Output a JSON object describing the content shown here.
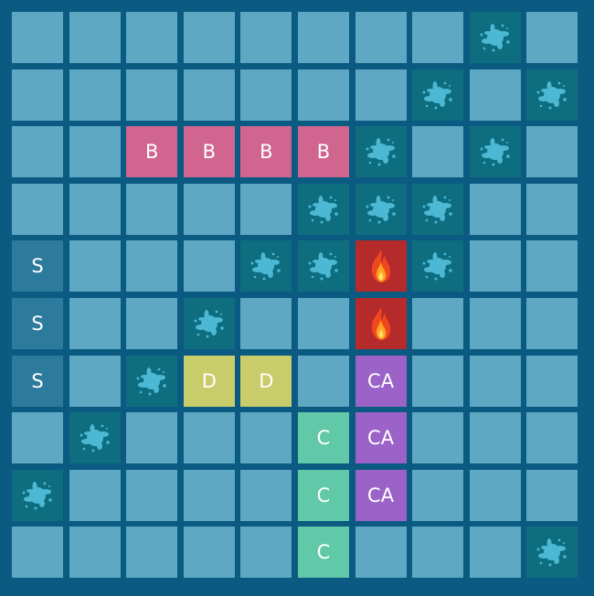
{
  "colors": {
    "water": "#5ea8c4",
    "miss": "#0e6e80",
    "splash": "#4cb8d4",
    "hit": "#b52a2a",
    "B": "#d0668f",
    "S": "#2c7a9c",
    "D": "#c9cc6a",
    "C": "#62c9a8",
    "CA": "#9b63c8"
  },
  "icons": {
    "miss": "water-splash-icon",
    "hit": "fire-icon"
  },
  "grid": [
    [
      "",
      "",
      "",
      "",
      "",
      "",
      "",
      "",
      "miss",
      ""
    ],
    [
      "",
      "",
      "",
      "",
      "",
      "",
      "",
      "miss",
      "",
      "miss"
    ],
    [
      "",
      "",
      "B",
      "B",
      "B",
      "B",
      "miss",
      "",
      "miss",
      ""
    ],
    [
      "",
      "",
      "",
      "",
      "",
      "miss",
      "miss",
      "miss",
      "",
      ""
    ],
    [
      "S",
      "",
      "",
      "",
      "miss",
      "miss",
      "hit",
      "miss",
      "",
      ""
    ],
    [
      "S",
      "",
      "",
      "miss",
      "",
      "",
      "hit",
      "",
      "",
      ""
    ],
    [
      "S",
      "",
      "miss",
      "D",
      "D",
      "",
      "CA",
      "",
      "",
      ""
    ],
    [
      "",
      "miss",
      "",
      "",
      "",
      "C",
      "CA",
      "",
      "",
      ""
    ],
    [
      "miss",
      "",
      "",
      "",
      "",
      "C",
      "CA",
      "",
      "",
      ""
    ],
    [
      "",
      "",
      "",
      "",
      "",
      "C",
      "",
      "",
      "",
      "miss"
    ]
  ]
}
